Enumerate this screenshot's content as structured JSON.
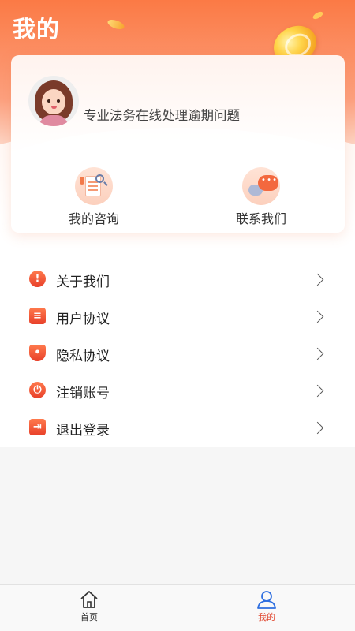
{
  "page": {
    "title": "我的"
  },
  "profile": {
    "slogan": "专业法务在线处理逾期问题"
  },
  "quick_actions": [
    {
      "label": "我的咨询",
      "icon": "consult-doc-icon"
    },
    {
      "label": "联系我们",
      "icon": "chat-bubbles-icon"
    }
  ],
  "menu": {
    "items": [
      {
        "label": "关于我们",
        "icon": "info-exclamation-icon"
      },
      {
        "label": "用户协议",
        "icon": "document-icon"
      },
      {
        "label": "隐私协议",
        "icon": "shield-icon"
      },
      {
        "label": "注销账号",
        "icon": "power-icon"
      },
      {
        "label": "退出登录",
        "icon": "logout-icon"
      }
    ]
  },
  "tabbar": {
    "items": [
      {
        "label": "首页",
        "icon": "home-icon",
        "active": false
      },
      {
        "label": "我的",
        "icon": "user-icon",
        "active": true
      }
    ]
  },
  "colors": {
    "accent": "#e8402a",
    "header_gradient_top": "#fb7a45",
    "active_tab": "#e0452d"
  }
}
